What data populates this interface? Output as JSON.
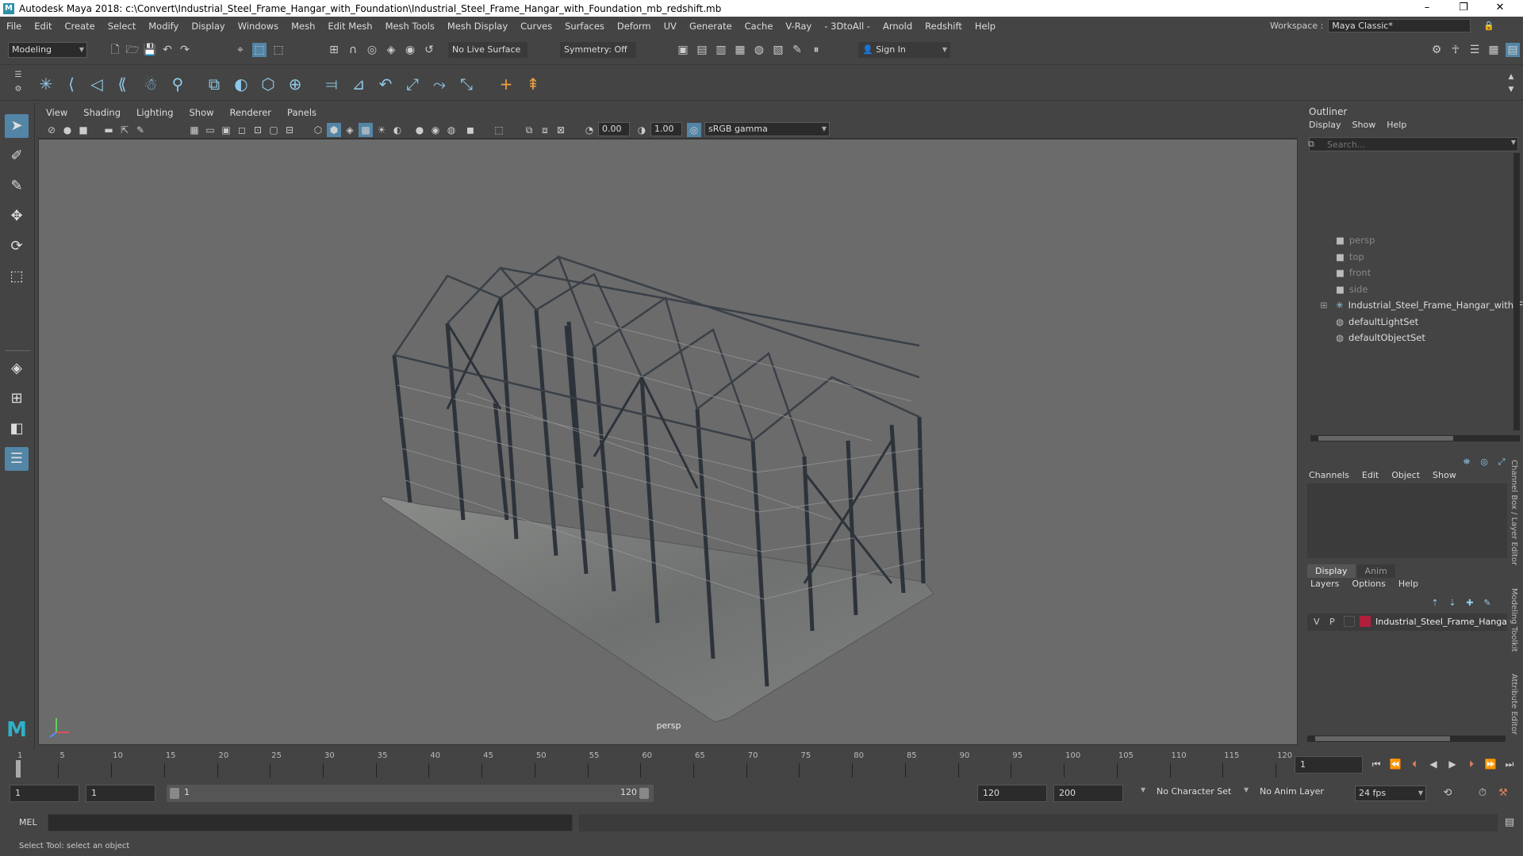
{
  "window": {
    "title": "Autodesk Maya 2018: c:\\Convert\\Industrial_Steel_Frame_Hangar_with_Foundation\\Industrial_Steel_Frame_Hangar_with_Foundation_mb_redshift.mb",
    "minimize": "–",
    "maximize": "❐",
    "close": "✕"
  },
  "menubar": {
    "items": [
      "File",
      "Edit",
      "Create",
      "Select",
      "Modify",
      "Display",
      "Windows",
      "Mesh",
      "Edit Mesh",
      "Mesh Tools",
      "Mesh Display",
      "Curves",
      "Surfaces",
      "Deform",
      "UV",
      "Generate",
      "Cache",
      "V-Ray",
      "- 3DtoAll -",
      "Arnold",
      "Redshift",
      "Help"
    ],
    "workspace_label": "Workspace :",
    "workspace_value": "Maya Classic*"
  },
  "statusline": {
    "mode": "Modeling",
    "live_surface": "No Live Surface",
    "symmetry": "Symmetry: Off",
    "sign_in": "Sign In"
  },
  "viewport": {
    "menu": [
      "View",
      "Shading",
      "Lighting",
      "Show",
      "Renderer",
      "Panels"
    ],
    "exposure": "0.00",
    "gamma": "1.00",
    "colorspace": "sRGB gamma",
    "camera_label": "persp"
  },
  "outliner": {
    "title": "Outliner",
    "menu": [
      "Display",
      "Show",
      "Help"
    ],
    "search_placeholder": "Search...",
    "items": [
      {
        "label": "persp",
        "icon": "camera-icon",
        "dim": true
      },
      {
        "label": "top",
        "icon": "camera-icon",
        "dim": true
      },
      {
        "label": "front",
        "icon": "camera-icon",
        "dim": true
      },
      {
        "label": "side",
        "icon": "camera-icon",
        "dim": true
      },
      {
        "label": "Industrial_Steel_Frame_Hangar_with_Fo",
        "icon": "transform-icon",
        "dim": false
      },
      {
        "label": "defaultLightSet",
        "icon": "set-icon",
        "dim": false
      },
      {
        "label": "defaultObjectSet",
        "icon": "set-icon",
        "dim": false
      }
    ]
  },
  "channelbox": {
    "menu": [
      "Channels",
      "Edit",
      "Object",
      "Show"
    ]
  },
  "layers": {
    "tabs": [
      "Display",
      "Anim"
    ],
    "menu": [
      "Layers",
      "Options",
      "Help"
    ],
    "layer": {
      "v": "V",
      "p": "P",
      "name": "Industrial_Steel_Frame_Hanga",
      "color": "#b0203a"
    }
  },
  "sidetabs": [
    "Channel Box / Layer Editor",
    "Modeling Toolkit",
    "Attribute Editor"
  ],
  "timeline": {
    "ticks": [
      "1",
      "5",
      "10",
      "15",
      "20",
      "25",
      "30",
      "35",
      "40",
      "45",
      "50",
      "55",
      "60",
      "65",
      "70",
      "75",
      "80",
      "85",
      "90",
      "95",
      "100",
      "105",
      "110",
      "115",
      "120"
    ],
    "current_frame": "1"
  },
  "range": {
    "start": "1",
    "playback_start": "1",
    "slider_start": "1",
    "slider_end": "120",
    "playback_end": "120",
    "end": "200",
    "character_set": "No Character Set",
    "anim_layer": "No Anim Layer",
    "fps": "24 fps"
  },
  "cmdline": {
    "label": "MEL"
  },
  "helpline": {
    "text": "Select Tool: select an object"
  },
  "colors": {
    "bg": "#444444",
    "viewport": "#6b6b6b",
    "accent": "#5285a6"
  }
}
